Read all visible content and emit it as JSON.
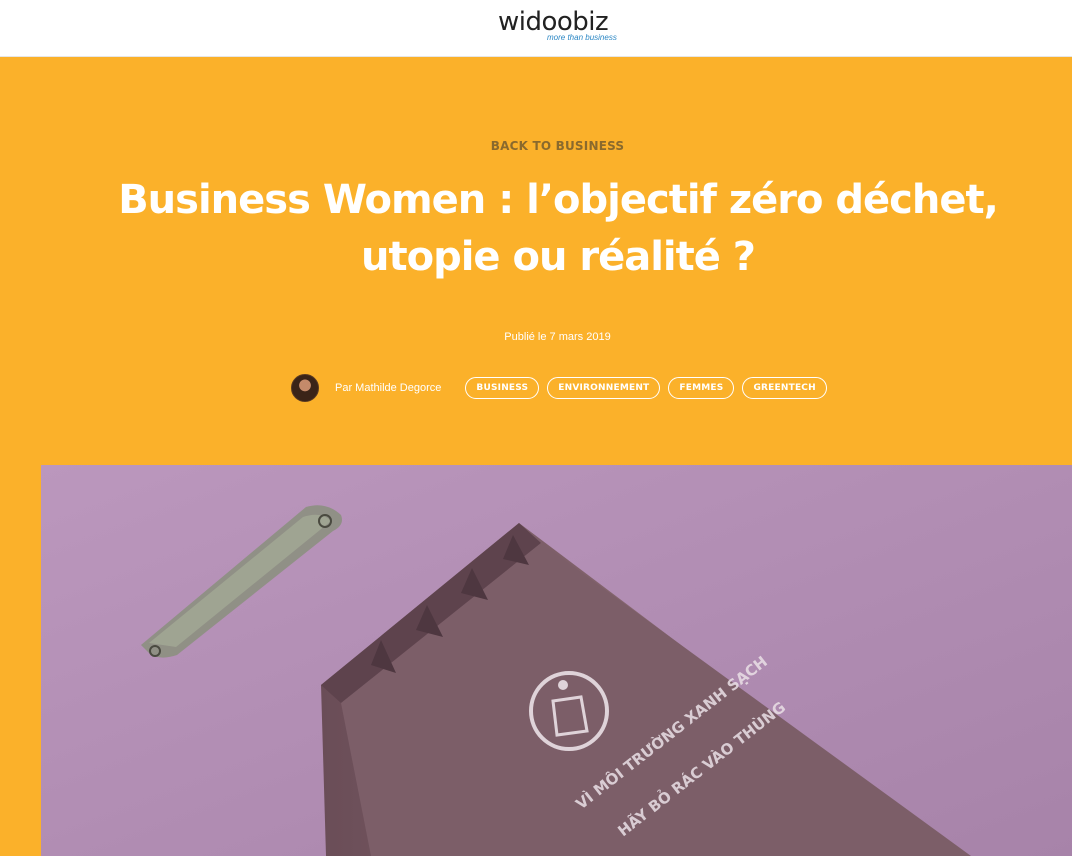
{
  "header": {
    "logo_text": "widoobiz",
    "logo_tagline": "more than business"
  },
  "article": {
    "category": "BACK TO BUSINESS",
    "title_line1": "Business Women : l’objectif zéro déchet,",
    "title_line2": "utopie ou réalité ?",
    "published": "Publié le 7 mars 2019",
    "author": "Par Mathilde Degorce",
    "tags": [
      "BUSINESS",
      "ENVIRONNEMENT",
      "FEMMES",
      "GREENTECH"
    ]
  },
  "image": {
    "bin_text_line1": "VÌ MÔI TRƯỜNG XANH SẠCH",
    "bin_text_line2": "HÃY BỎ RÁC VÀO THÙNG"
  },
  "colors": {
    "accent": "#fbb12a",
    "category_text": "#8a6a2d",
    "image_background": "#b390b4",
    "bin": "#7a5c66"
  }
}
